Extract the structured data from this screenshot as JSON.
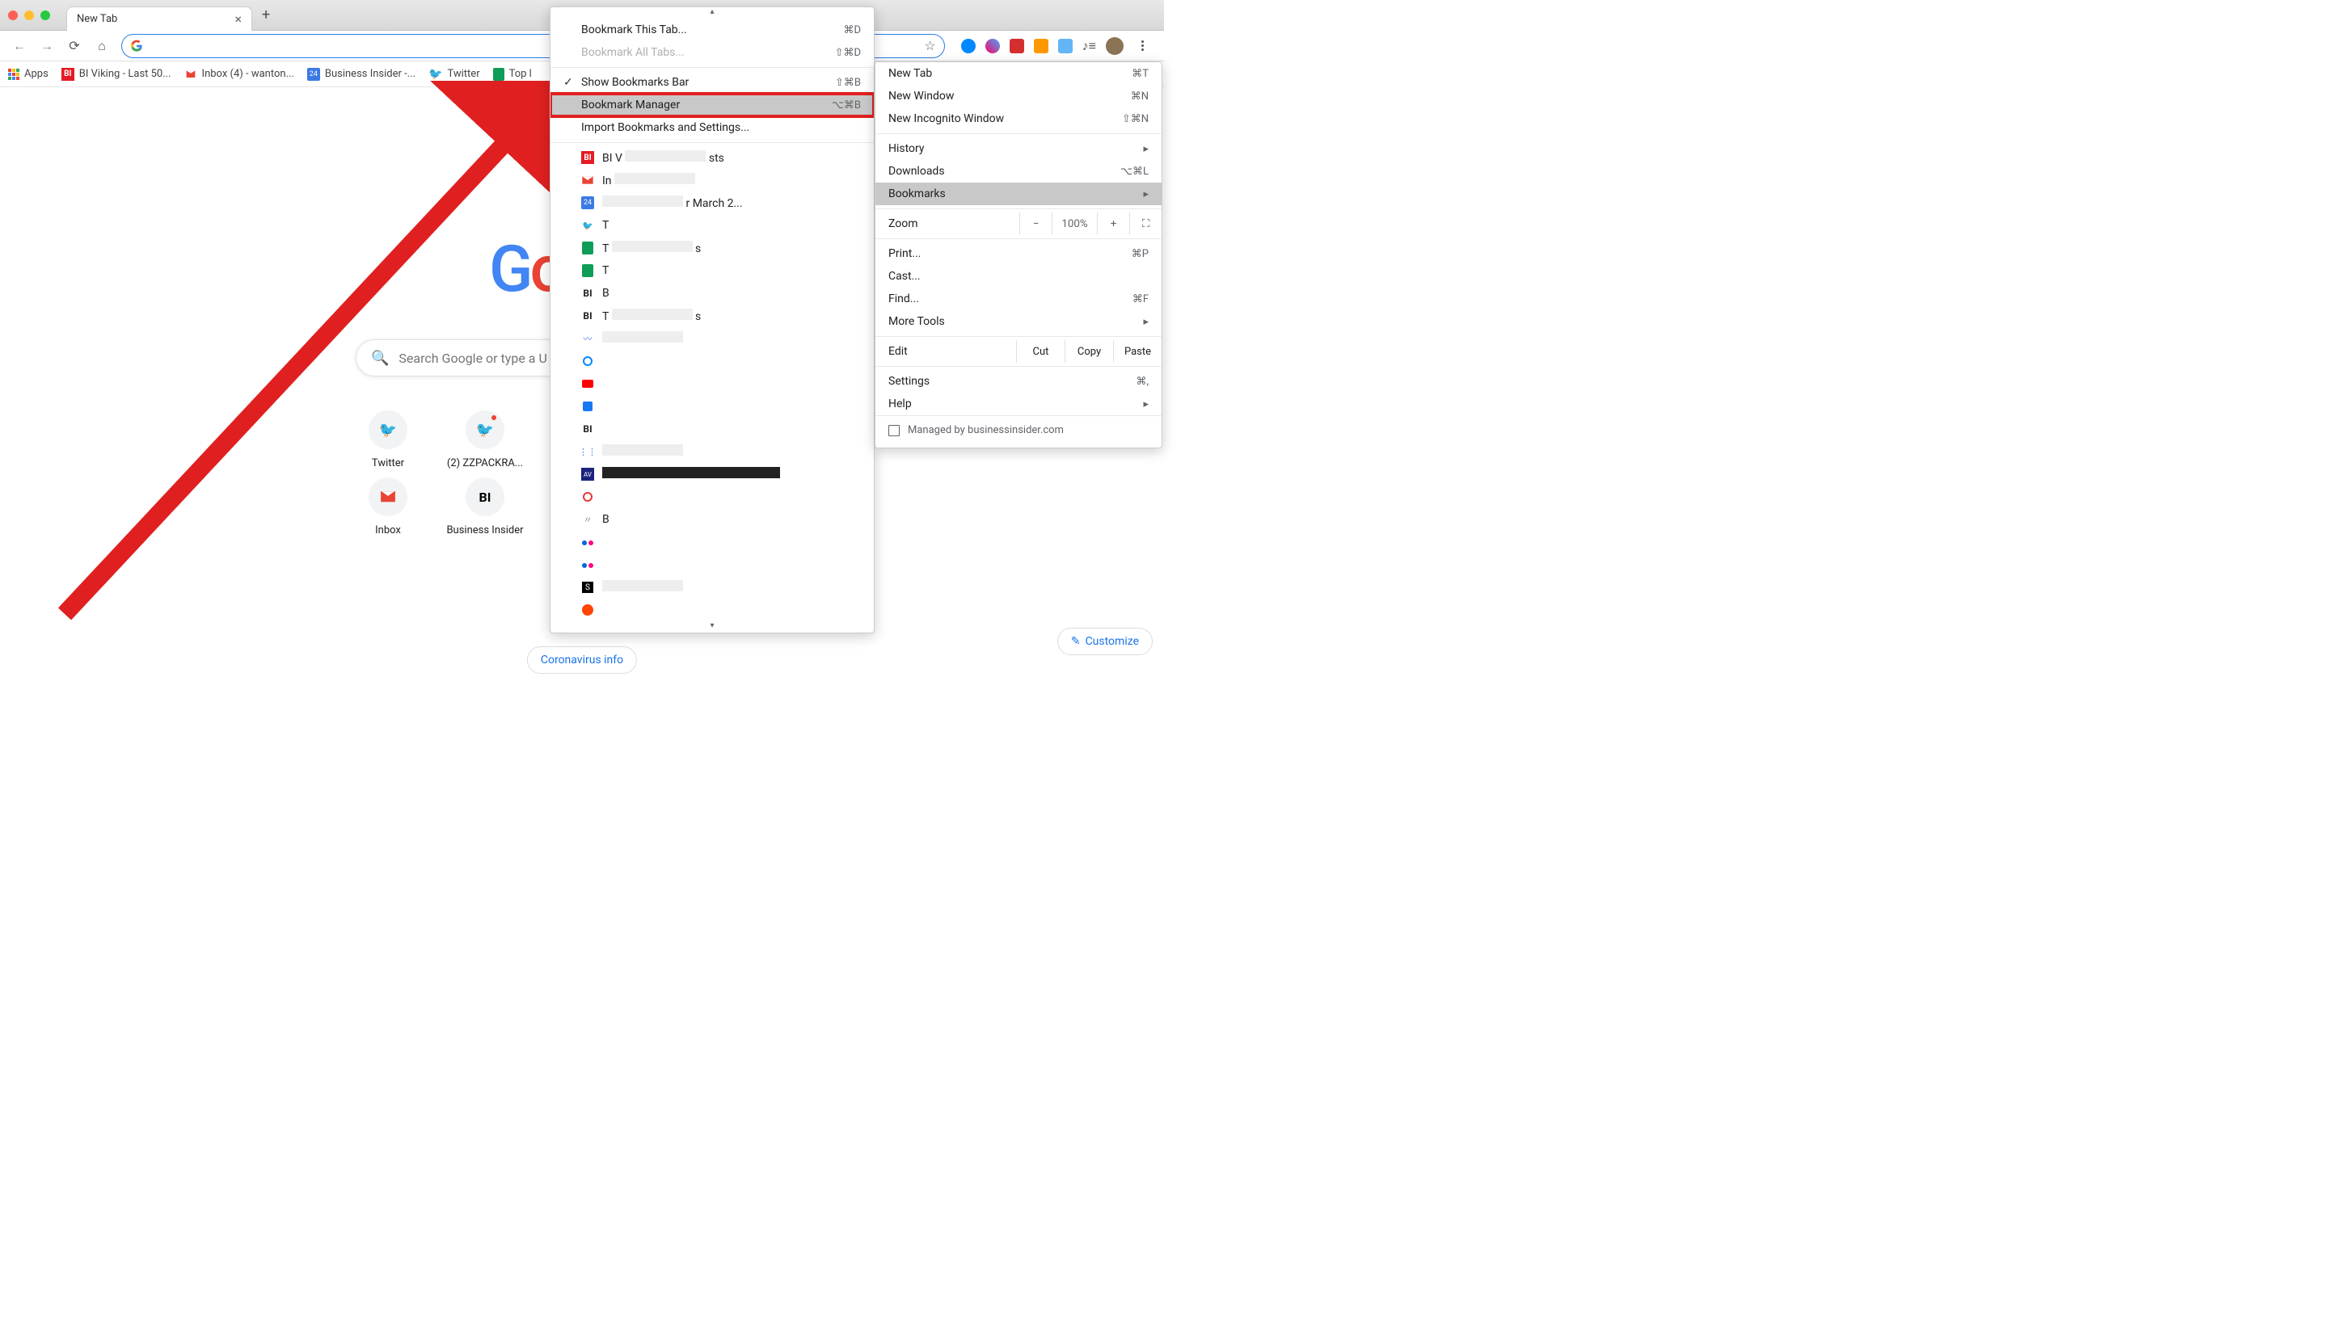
{
  "tab": {
    "title": "New Tab"
  },
  "omnibox": {
    "placeholder": ""
  },
  "bookmarksBar": {
    "apps": "Apps",
    "items": [
      {
        "label": "BI Viking - Last 50..."
      },
      {
        "label": "Inbox (4) - wanton..."
      },
      {
        "label": "Business Insider -..."
      },
      {
        "label": "Twitter"
      },
      {
        "label": "Top l"
      }
    ]
  },
  "searchbox": {
    "placeholder": "Search Google or type a U"
  },
  "tiles": [
    {
      "label": "Twitter",
      "icon": "twitter"
    },
    {
      "label": "(2) ZZPACKRA...",
      "icon": "twitter"
    },
    {
      "label": "Inbox",
      "icon": "gmail"
    },
    {
      "label": "Business Insider",
      "icon": "bi"
    }
  ],
  "covid": "Coronavirus info",
  "customize": "Customize",
  "mainMenu": {
    "newTab": {
      "label": "New Tab",
      "sc": "⌘T"
    },
    "newWindow": {
      "label": "New Window",
      "sc": "⌘N"
    },
    "newIncognito": {
      "label": "New Incognito Window",
      "sc": "⇧⌘N"
    },
    "history": {
      "label": "History"
    },
    "downloads": {
      "label": "Downloads",
      "sc": "⌥⌘L"
    },
    "bookmarks": {
      "label": "Bookmarks"
    },
    "zoom": {
      "label": "Zoom",
      "value": "100%"
    },
    "print": {
      "label": "Print...",
      "sc": "⌘P"
    },
    "cast": {
      "label": "Cast..."
    },
    "find": {
      "label": "Find...",
      "sc": "⌘F"
    },
    "moreTools": {
      "label": "More Tools"
    },
    "edit": {
      "label": "Edit",
      "cut": "Cut",
      "copy": "Copy",
      "paste": "Paste"
    },
    "settings": {
      "label": "Settings",
      "sc": "⌘,"
    },
    "help": {
      "label": "Help"
    },
    "managed": "Managed by businessinsider.com"
  },
  "bookmarksSubmenu": {
    "bookmarkThis": {
      "label": "Bookmark This Tab...",
      "sc": "⌘D"
    },
    "bookmarkAll": {
      "label": "Bookmark All Tabs...",
      "sc": "⇧⌘D"
    },
    "showBar": {
      "label": "Show Bookmarks Bar",
      "sc": "⇧⌘B"
    },
    "manager": {
      "label": "Bookmark Manager",
      "sc": "⌥⌘B"
    },
    "import": {
      "label": "Import Bookmarks and Settings..."
    },
    "list": [
      {
        "icon": "bi",
        "text": "BI V",
        "blurred": true,
        "after": "sts"
      },
      {
        "icon": "gmail",
        "text": "In",
        "blurred": true
      },
      {
        "icon": "cal",
        "text": "",
        "blurred": true,
        "after": "r March 2..."
      },
      {
        "icon": "twitter",
        "text": "T",
        "blurred": false
      },
      {
        "icon": "sheets",
        "text": "T",
        "blurred": true,
        "after": "s"
      },
      {
        "icon": "sheets",
        "text": "T",
        "blurred": false
      },
      {
        "icon": "bitext",
        "text": "B",
        "blurred": false
      },
      {
        "icon": "bitext",
        "text": "T",
        "blurred": true,
        "after": "s"
      },
      {
        "icon": "wave",
        "text": "",
        "blurred": true
      },
      {
        "icon": "circle-blue",
        "text": ""
      },
      {
        "icon": "youtube",
        "text": ""
      },
      {
        "icon": "facebook",
        "text": ""
      },
      {
        "icon": "bitext",
        "text": ""
      },
      {
        "icon": "dots",
        "text": "",
        "blurred": true
      },
      {
        "icon": "av",
        "text": "",
        "blurred": true,
        "dark": true
      },
      {
        "icon": "circle-red",
        "text": ""
      },
      {
        "icon": "wave2",
        "text": "B",
        "blurred": false
      },
      {
        "icon": "flickr",
        "text": ""
      },
      {
        "icon": "flickr",
        "text": ""
      },
      {
        "icon": "s-black",
        "text": "",
        "blurred": true
      },
      {
        "icon": "reddit",
        "text": ""
      }
    ]
  }
}
